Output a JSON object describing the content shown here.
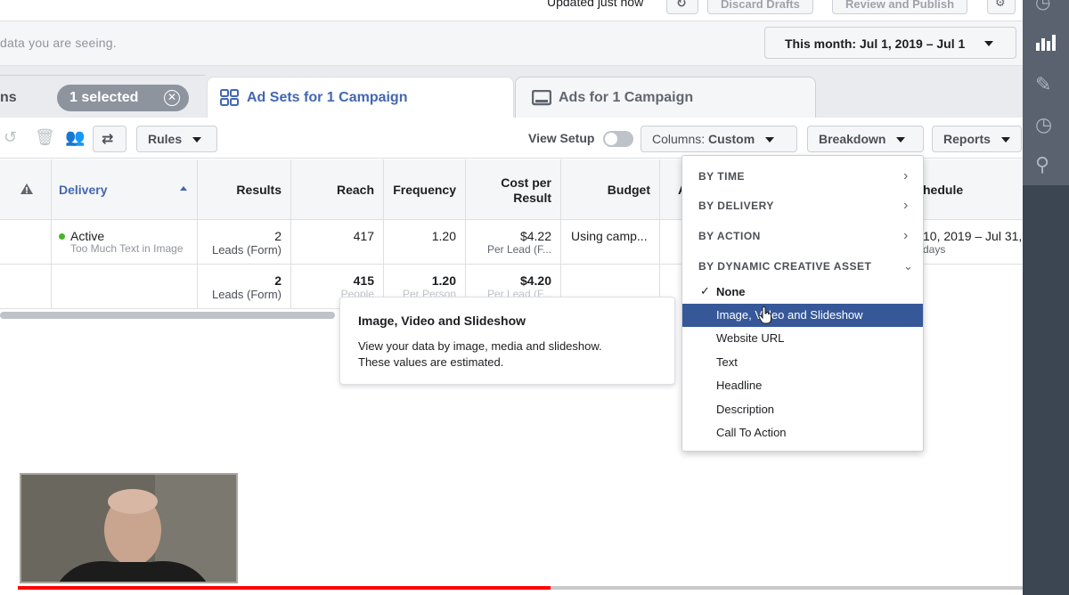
{
  "top": {
    "updated": "Updated just now",
    "discard": "Discard Drafts",
    "review": "Review and Publish"
  },
  "info": {
    "hint": "data you are seeing.",
    "date_range": "This month: Jul 1, 2019 – Jul 1"
  },
  "tabs": {
    "campaigns_partial": "ns",
    "selected": "1 selected",
    "adsets": "Ad Sets for 1 Campaign",
    "ads": "Ads for 1 Campaign"
  },
  "toolbar": {
    "rules": "Rules",
    "view_setup": "View Setup",
    "columns_prefix": "Columns:",
    "columns_value": "Custom",
    "breakdown": "Breakdown",
    "reports": "Reports"
  },
  "table": {
    "headers": {
      "delivery": "Delivery",
      "results": "Results",
      "reach": "Reach",
      "frequency": "Frequency",
      "cost_per_result_1": "Cost per",
      "cost_per_result_2": "Result",
      "budget": "Budget",
      "partial_a": "A",
      "schedule": "hedule"
    },
    "row1": {
      "delivery_status": "Active",
      "delivery_sub": "Too Much Text in Image",
      "results": "2",
      "results_sub": "Leads (Form)",
      "reach": "417",
      "frequency": "1.20",
      "cost": "$4.22",
      "cost_sub": "Per Lead (F...",
      "budget": "Using camp...",
      "schedule": "10, 2019 – Jul 31,",
      "schedule_sub": "days"
    },
    "row2": {
      "results": "2",
      "results_sub": "Leads (Form)",
      "reach": "415",
      "reach_sub": "People",
      "frequency": "1.20",
      "frequency_sub": "Per Person",
      "cost": "$4.20",
      "cost_sub": "Per Lead (F..."
    }
  },
  "tooltip": {
    "title": "Image, Video and Slideshow",
    "line1": "View your data by image, media and slideshow.",
    "line2": "These values are estimated."
  },
  "breakdown_menu": {
    "headers": [
      "BY TIME",
      "BY DELIVERY",
      "BY ACTION",
      "BY DYNAMIC CREATIVE ASSET"
    ],
    "items": [
      "None",
      "Image, Video and Slideshow",
      "Website URL",
      "Text",
      "Headline",
      "Description",
      "Call To Action"
    ],
    "selected": "None",
    "hovered": "Image, Video and Slideshow"
  },
  "video_progress": 0.53,
  "colors": {
    "accent": "#4267b2",
    "highlight": "#365899",
    "status_green": "#42b72a",
    "rail": "#3c4552"
  }
}
